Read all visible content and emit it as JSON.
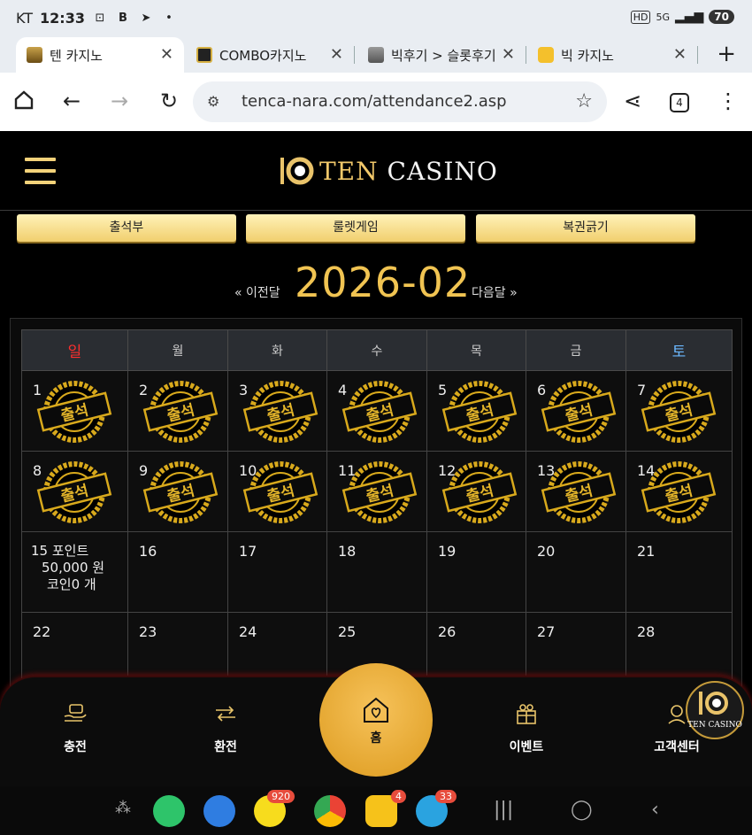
{
  "status": {
    "carrier": "KT",
    "time": "12:33",
    "battery": "70"
  },
  "tabs": [
    {
      "title": "텐 카지노",
      "active": true
    },
    {
      "title": "COMBO카지노",
      "active": false
    },
    {
      "title": "빅후기 > 슬롯후기 |",
      "active": false
    },
    {
      "title": "빅 카지노",
      "active": false
    }
  ],
  "browser": {
    "url": "tenca-nara.com/attendance2.asp",
    "tab_count": "4"
  },
  "site": {
    "logo_text_1": "TEN",
    "logo_text_2": "CASINO",
    "menu": [
      "출석부",
      "룰렛게임",
      "복권긁기"
    ]
  },
  "month_nav": {
    "prev": "« 이전달",
    "next": "다음달 »",
    "title": "2026-02"
  },
  "calendar": {
    "weekdays": [
      "일",
      "월",
      "화",
      "수",
      "목",
      "금",
      "토"
    ],
    "stamp_label": "출석",
    "weeks": [
      [
        "1",
        "2",
        "3",
        "4",
        "5",
        "6",
        "7"
      ],
      [
        "8",
        "9",
        "10",
        "11",
        "12",
        "13",
        "14"
      ],
      [
        "15",
        "16",
        "17",
        "18",
        "19",
        "20",
        "21"
      ],
      [
        "22",
        "23",
        "24",
        "25",
        "26",
        "27",
        "28"
      ]
    ],
    "today_info": {
      "line1": "포인트",
      "line2": "50,000 원",
      "line3": "코인0 개"
    }
  },
  "bottom_nav": [
    {
      "label": "충전",
      "icon": "money-hand-icon"
    },
    {
      "label": "환전",
      "icon": "exchange-hand-icon"
    },
    {
      "label": "홈",
      "icon": "home-heart-icon"
    },
    {
      "label": "이벤트",
      "icon": "gift-icon"
    },
    {
      "label": "고객센터",
      "icon": "headset-icon"
    }
  ],
  "floating_logo_text": "TEN CASINO",
  "android_apps": [
    {
      "name": "phone",
      "badge": ""
    },
    {
      "name": "messages",
      "badge": ""
    },
    {
      "name": "kakaotalk",
      "badge": "920"
    },
    {
      "name": "chrome",
      "badge": ""
    },
    {
      "name": "b-app",
      "badge": "4"
    },
    {
      "name": "telegram",
      "badge": "33"
    }
  ]
}
